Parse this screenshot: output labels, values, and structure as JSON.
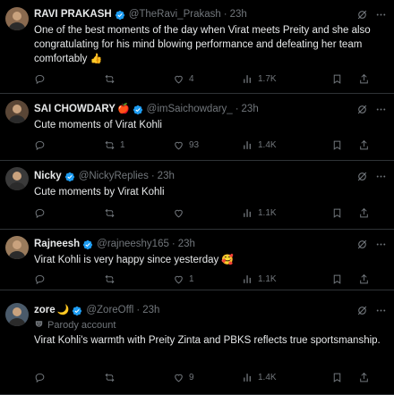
{
  "tweets": [
    {
      "name": "RAVI PRAKASH",
      "handle": "@TheRavi_Prakash",
      "time": "23h",
      "text": "One of the best moments of the day when Virat  meets Preity and she also congratulating for his mind blowing performance and defeating her team comfortably",
      "emoji": "👍",
      "reply": "",
      "retweet": "",
      "like": "4",
      "views": "1.7K",
      "avatar_color": "#8a6a4f"
    },
    {
      "name": "SAI CHOWDARY",
      "name_suffix": "🍎",
      "handle": "@imSaichowdary_",
      "time": "23h",
      "text": "Cute moments of Virat Kohli",
      "emoji": "",
      "reply": "",
      "retweet": "1",
      "like": "93",
      "views": "1.4K",
      "avatar_color": "#5a4636"
    },
    {
      "name": "Nicky",
      "handle": "@NickyReplies",
      "time": "23h",
      "text": "Cute moments by Virat Kohli",
      "emoji": "",
      "reply": "",
      "retweet": "",
      "like": "",
      "views": "1.1K",
      "avatar_color": "#3a3a3a"
    },
    {
      "name": "Rajneesh",
      "handle": "@rajneeshy165",
      "time": "23h",
      "text": "Virat Kohli is very happy since yesterday",
      "emoji": "🥰",
      "reply": "",
      "retweet": "",
      "like": "1",
      "views": "1.1K",
      "avatar_color": "#9a7b5c"
    },
    {
      "name": "zore",
      "name_suffix": "🌙",
      "handle": "@ZoreOffl",
      "time": "23h",
      "parody": "Parody account",
      "text": "Virat Kohli's warmth with Preity Zinta and PBKS reflects true sportsmanship.",
      "emoji": "",
      "reply": "",
      "retweet": "",
      "like": "9",
      "views": "1.4K",
      "avatar_color": "#4a5a6a"
    }
  ],
  "icons": {
    "verified": "verified-badge-icon",
    "grok": "grok-icon",
    "more": "more-icon",
    "reply": "reply-icon",
    "retweet": "retweet-icon",
    "like": "like-icon",
    "views": "views-icon",
    "bookmark": "bookmark-icon",
    "share": "share-icon",
    "parody": "parody-mask-icon"
  },
  "colors": {
    "background": "#000000",
    "text": "#e7e9ea",
    "secondary": "#71767b",
    "verified": "#1d9bf0",
    "divider": "#2f3336"
  }
}
